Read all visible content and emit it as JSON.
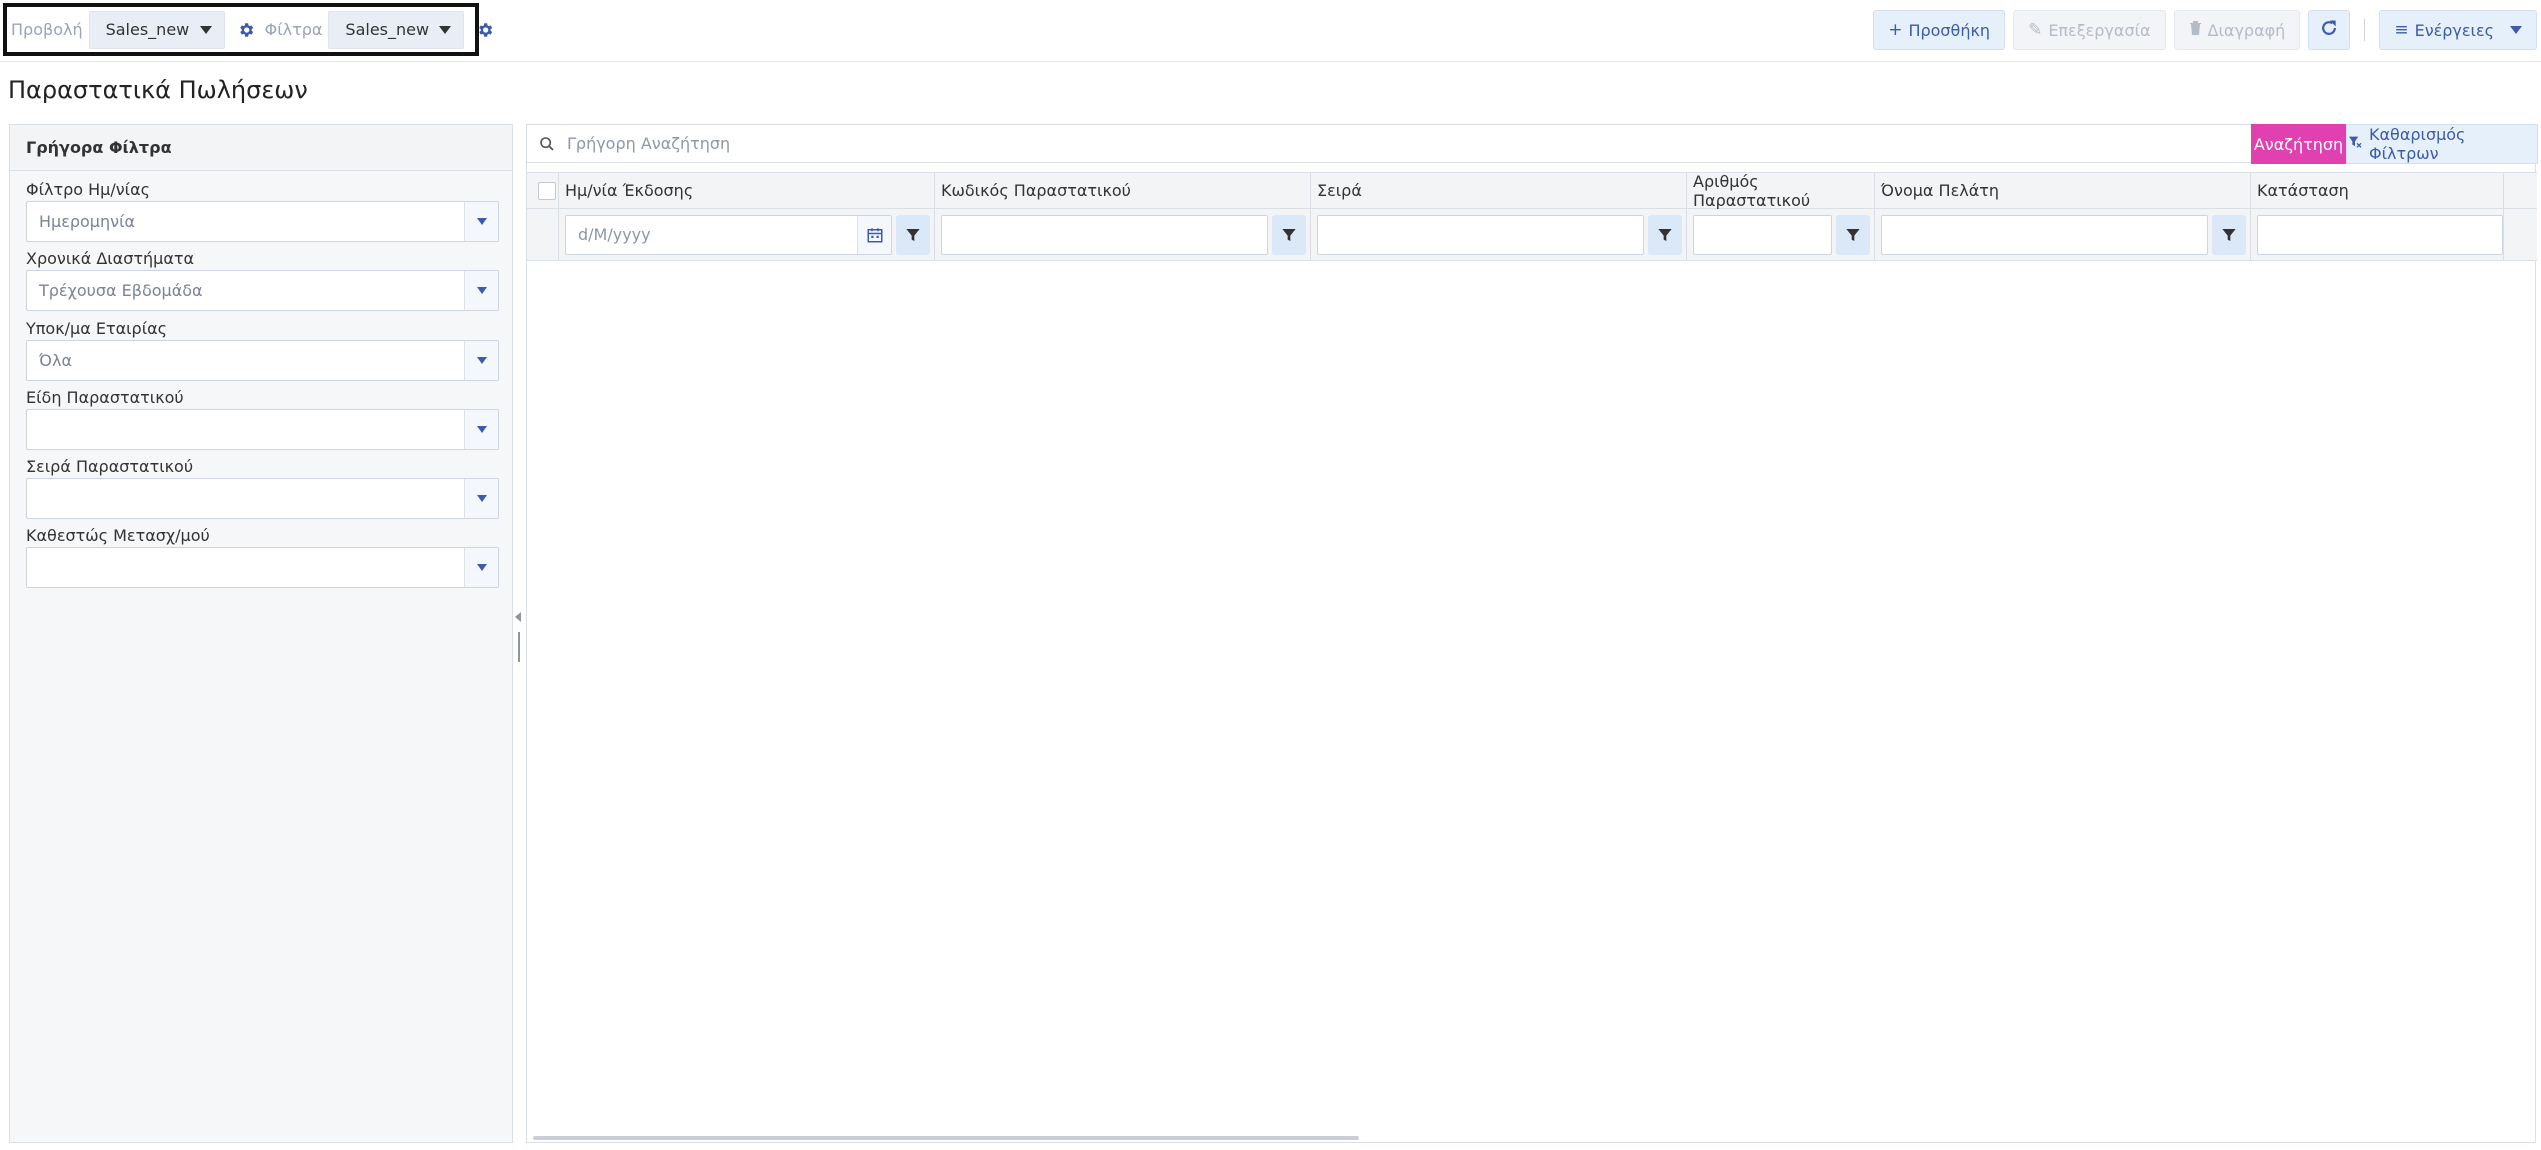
{
  "toolbar": {
    "view_label": "Προβολή",
    "view_value": "Sales_new",
    "filters_label": "Φίλτρα",
    "filters_value": "Sales_new",
    "add_label": "Προσθήκη",
    "edit_label": "Επεξεργασία",
    "delete_label": "Διαγραφή",
    "actions_label": "Ενέργειες"
  },
  "page": {
    "title": "Παραστατικά Πωλήσεων"
  },
  "sidebar": {
    "title": "Γρήγορα Φίλτρα",
    "filters": [
      {
        "label": "Φίλτρο Ημ/νίας",
        "value": "Ημερομηνία"
      },
      {
        "label": "Χρονικά Διαστήματα",
        "value": "Τρέχουσα Εβδομάδα"
      },
      {
        "label": "Υποκ/μα Εταιρίας",
        "value": "Όλα"
      },
      {
        "label": "Είδη Παραστατικού",
        "value": ""
      },
      {
        "label": "Σειρά Παραστατικού",
        "value": ""
      },
      {
        "label": "Καθεστώς Μετασχ/μού",
        "value": ""
      }
    ]
  },
  "grid": {
    "search_placeholder": "Γρήγορη Αναζήτηση",
    "search_button": "Αναζήτηση",
    "clear_button": "Καθαρισμός Φίλτρων",
    "date_placeholder": "d/M/yyyy",
    "columns": [
      {
        "label": "Ημ/νία Έκδοσης"
      },
      {
        "label": "Κωδικός Παραστατικού"
      },
      {
        "label": "Σειρά"
      },
      {
        "label": "Αριθμός Παραστατικού"
      },
      {
        "label": "Όνομα Πελάτη"
      },
      {
        "label": "Κατάσταση"
      }
    ]
  },
  "colors": {
    "accent": "#3b5bab",
    "search_button": "#e040b0",
    "button_bg": "#e6f0fb"
  },
  "icons": [
    "gear-icon",
    "plus-icon",
    "pencil-icon",
    "trash-icon",
    "refresh-icon",
    "menu-icon",
    "search-icon",
    "filter-clear-icon",
    "calendar-icon",
    "filter-icon"
  ]
}
